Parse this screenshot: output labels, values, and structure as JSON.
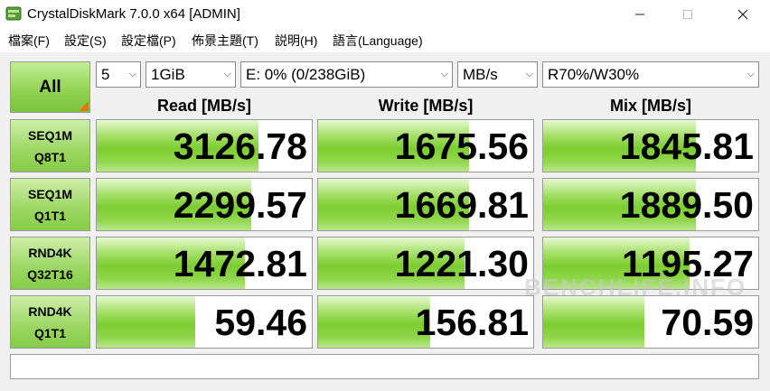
{
  "window": {
    "title": "CrystalDiskMark 7.0.0 x64 [ADMIN]"
  },
  "menu": [
    "檔案(F)",
    "設定(S)",
    "設定檔(P)",
    "佈景主題(T)",
    "説明(H)",
    "語言(Language)"
  ],
  "controls": {
    "all_label": "All",
    "count": "5",
    "size": "1GiB",
    "drive": "E: 0% (0/238GiB)",
    "unit": "MB/s",
    "mix": "R70%/W30%"
  },
  "headers": {
    "read": "Read [MB/s]",
    "write": "Write [MB/s]",
    "mix": "Mix [MB/s]"
  },
  "rows": [
    {
      "line1": "SEQ1M",
      "line2": "Q8T1",
      "read": "3126.78",
      "write": "1675.56",
      "mix": "1845.81"
    },
    {
      "line1": "SEQ1M",
      "line2": "Q1T1",
      "read": "2299.57",
      "write": "1669.81",
      "mix": "1889.50"
    },
    {
      "line1": "RND4K",
      "line2": "Q32T16",
      "read": "1472.81",
      "write": "1221.30",
      "mix": "1195.27"
    },
    {
      "line1": "RND4K",
      "line2": "Q1T1",
      "read": "59.46",
      "write": "156.81",
      "mix": "70.59"
    }
  ],
  "bar_fill_fraction": [
    {
      "read": 0.75,
      "write": 0.7,
      "mix": 0.71
    },
    {
      "read": 0.72,
      "write": 0.7,
      "mix": 0.71
    },
    {
      "read": 0.69,
      "write": 0.68,
      "mix": 0.68
    },
    {
      "read": 0.46,
      "write": 0.52,
      "mix": 0.47
    }
  ],
  "watermark": "BENCHLIFE.INFO",
  "colors": {
    "accent_green": "#7ccd31",
    "corner_orange": "#e8730f"
  }
}
